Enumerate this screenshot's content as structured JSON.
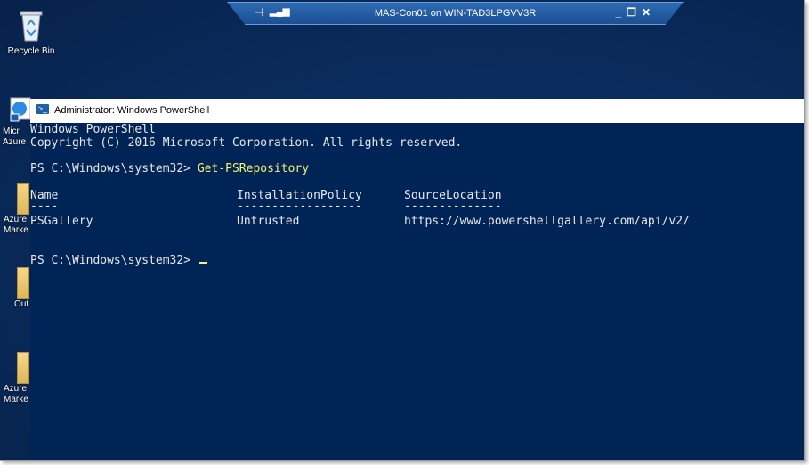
{
  "rdp_bar": {
    "title": "MAS-Con01 on WIN-TAD3LPGVV3R",
    "pin_icon": "pin-icon",
    "signal_icon": "signal-bars-icon",
    "minimize_label": "_",
    "restore_label": "❐",
    "close_label": "✕"
  },
  "desktop": {
    "icons": [
      {
        "label": "Recycle Bin",
        "icon": "recycle-bin-icon"
      },
      {
        "label": "Micr Azure",
        "icon": "browser-icon"
      },
      {
        "label": "Azure Marke",
        "icon": "folder-icon"
      },
      {
        "label": "Out",
        "icon": "folder-icon"
      },
      {
        "label": "Azure Marke",
        "icon": "folder-icon"
      }
    ]
  },
  "powershell": {
    "window_title": "Administrator: Windows PowerShell",
    "lines": {
      "banner1": "Windows PowerShell",
      "banner2": "Copyright (C) 2016 Microsoft Corporation. All rights reserved.",
      "prompt1": "PS C:\\Windows\\system32> ",
      "command1": "Get-PSRepository",
      "prompt2": "PS C:\\Windows\\system32> "
    },
    "table": {
      "headers": [
        "Name",
        "InstallationPolicy",
        "SourceLocation"
      ],
      "separators": [
        "----",
        "------------------",
        "--------------"
      ],
      "rows": [
        [
          "PSGallery",
          "Untrusted",
          "https://www.powershellgallery.com/api/v2/"
        ]
      ]
    }
  },
  "colors": {
    "console_bg": "#012456",
    "command_yellow": "#f5f36a",
    "desktop_bg": "#0a2d60"
  }
}
